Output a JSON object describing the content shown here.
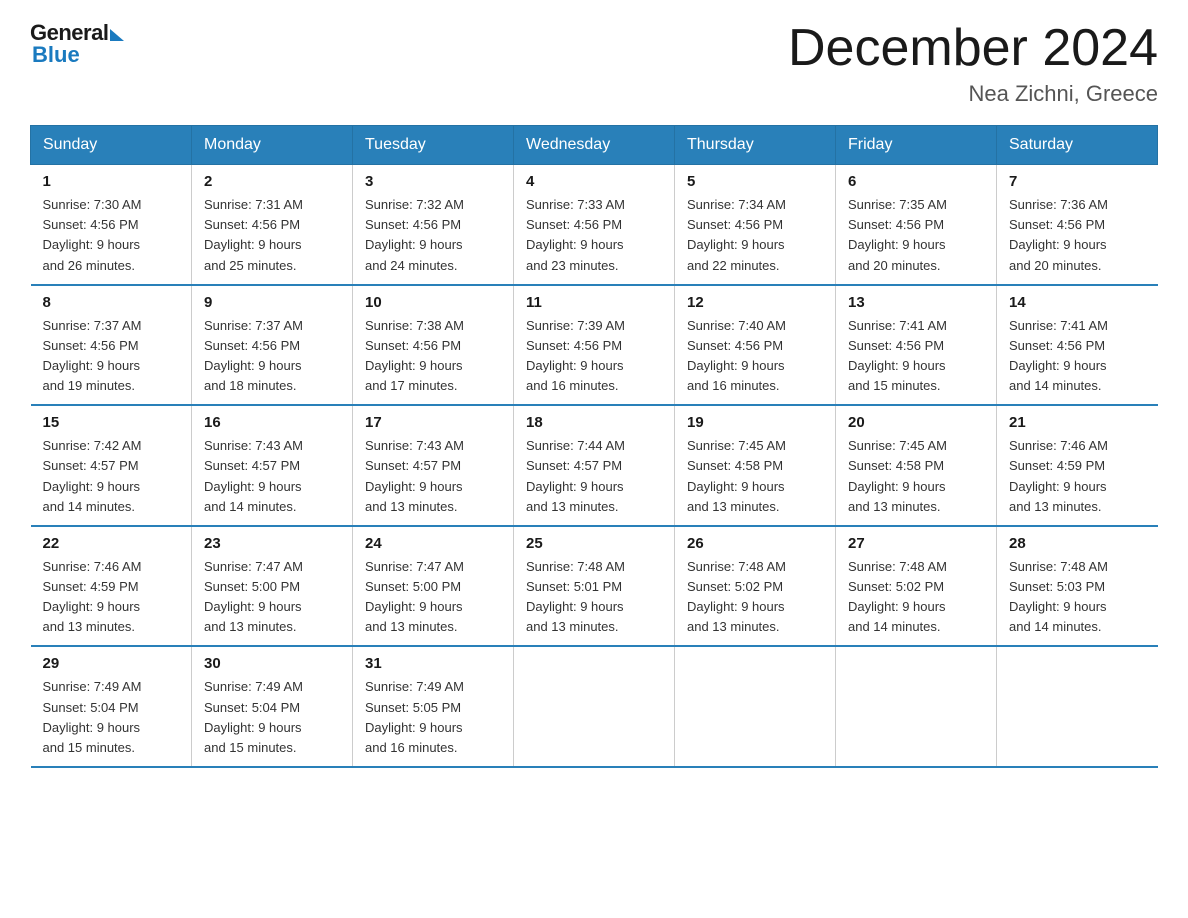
{
  "header": {
    "logo_general": "General",
    "logo_blue": "Blue",
    "title": "December 2024",
    "location": "Nea Zichni, Greece"
  },
  "weekdays": [
    "Sunday",
    "Monday",
    "Tuesday",
    "Wednesday",
    "Thursday",
    "Friday",
    "Saturday"
  ],
  "weeks": [
    [
      {
        "day": "1",
        "sunrise": "7:30 AM",
        "sunset": "4:56 PM",
        "daylight": "9 hours and 26 minutes."
      },
      {
        "day": "2",
        "sunrise": "7:31 AM",
        "sunset": "4:56 PM",
        "daylight": "9 hours and 25 minutes."
      },
      {
        "day": "3",
        "sunrise": "7:32 AM",
        "sunset": "4:56 PM",
        "daylight": "9 hours and 24 minutes."
      },
      {
        "day": "4",
        "sunrise": "7:33 AM",
        "sunset": "4:56 PM",
        "daylight": "9 hours and 23 minutes."
      },
      {
        "day": "5",
        "sunrise": "7:34 AM",
        "sunset": "4:56 PM",
        "daylight": "9 hours and 22 minutes."
      },
      {
        "day": "6",
        "sunrise": "7:35 AM",
        "sunset": "4:56 PM",
        "daylight": "9 hours and 20 minutes."
      },
      {
        "day": "7",
        "sunrise": "7:36 AM",
        "sunset": "4:56 PM",
        "daylight": "9 hours and 20 minutes."
      }
    ],
    [
      {
        "day": "8",
        "sunrise": "7:37 AM",
        "sunset": "4:56 PM",
        "daylight": "9 hours and 19 minutes."
      },
      {
        "day": "9",
        "sunrise": "7:37 AM",
        "sunset": "4:56 PM",
        "daylight": "9 hours and 18 minutes."
      },
      {
        "day": "10",
        "sunrise": "7:38 AM",
        "sunset": "4:56 PM",
        "daylight": "9 hours and 17 minutes."
      },
      {
        "day": "11",
        "sunrise": "7:39 AM",
        "sunset": "4:56 PM",
        "daylight": "9 hours and 16 minutes."
      },
      {
        "day": "12",
        "sunrise": "7:40 AM",
        "sunset": "4:56 PM",
        "daylight": "9 hours and 16 minutes."
      },
      {
        "day": "13",
        "sunrise": "7:41 AM",
        "sunset": "4:56 PM",
        "daylight": "9 hours and 15 minutes."
      },
      {
        "day": "14",
        "sunrise": "7:41 AM",
        "sunset": "4:56 PM",
        "daylight": "9 hours and 14 minutes."
      }
    ],
    [
      {
        "day": "15",
        "sunrise": "7:42 AM",
        "sunset": "4:57 PM",
        "daylight": "9 hours and 14 minutes."
      },
      {
        "day": "16",
        "sunrise": "7:43 AM",
        "sunset": "4:57 PM",
        "daylight": "9 hours and 14 minutes."
      },
      {
        "day": "17",
        "sunrise": "7:43 AM",
        "sunset": "4:57 PM",
        "daylight": "9 hours and 13 minutes."
      },
      {
        "day": "18",
        "sunrise": "7:44 AM",
        "sunset": "4:57 PM",
        "daylight": "9 hours and 13 minutes."
      },
      {
        "day": "19",
        "sunrise": "7:45 AM",
        "sunset": "4:58 PM",
        "daylight": "9 hours and 13 minutes."
      },
      {
        "day": "20",
        "sunrise": "7:45 AM",
        "sunset": "4:58 PM",
        "daylight": "9 hours and 13 minutes."
      },
      {
        "day": "21",
        "sunrise": "7:46 AM",
        "sunset": "4:59 PM",
        "daylight": "9 hours and 13 minutes."
      }
    ],
    [
      {
        "day": "22",
        "sunrise": "7:46 AM",
        "sunset": "4:59 PM",
        "daylight": "9 hours and 13 minutes."
      },
      {
        "day": "23",
        "sunrise": "7:47 AM",
        "sunset": "5:00 PM",
        "daylight": "9 hours and 13 minutes."
      },
      {
        "day": "24",
        "sunrise": "7:47 AM",
        "sunset": "5:00 PM",
        "daylight": "9 hours and 13 minutes."
      },
      {
        "day": "25",
        "sunrise": "7:48 AM",
        "sunset": "5:01 PM",
        "daylight": "9 hours and 13 minutes."
      },
      {
        "day": "26",
        "sunrise": "7:48 AM",
        "sunset": "5:02 PM",
        "daylight": "9 hours and 13 minutes."
      },
      {
        "day": "27",
        "sunrise": "7:48 AM",
        "sunset": "5:02 PM",
        "daylight": "9 hours and 14 minutes."
      },
      {
        "day": "28",
        "sunrise": "7:48 AM",
        "sunset": "5:03 PM",
        "daylight": "9 hours and 14 minutes."
      }
    ],
    [
      {
        "day": "29",
        "sunrise": "7:49 AM",
        "sunset": "5:04 PM",
        "daylight": "9 hours and 15 minutes."
      },
      {
        "day": "30",
        "sunrise": "7:49 AM",
        "sunset": "5:04 PM",
        "daylight": "9 hours and 15 minutes."
      },
      {
        "day": "31",
        "sunrise": "7:49 AM",
        "sunset": "5:05 PM",
        "daylight": "9 hours and 16 minutes."
      },
      null,
      null,
      null,
      null
    ]
  ],
  "labels": {
    "sunrise": "Sunrise:",
    "sunset": "Sunset:",
    "daylight": "Daylight:"
  }
}
